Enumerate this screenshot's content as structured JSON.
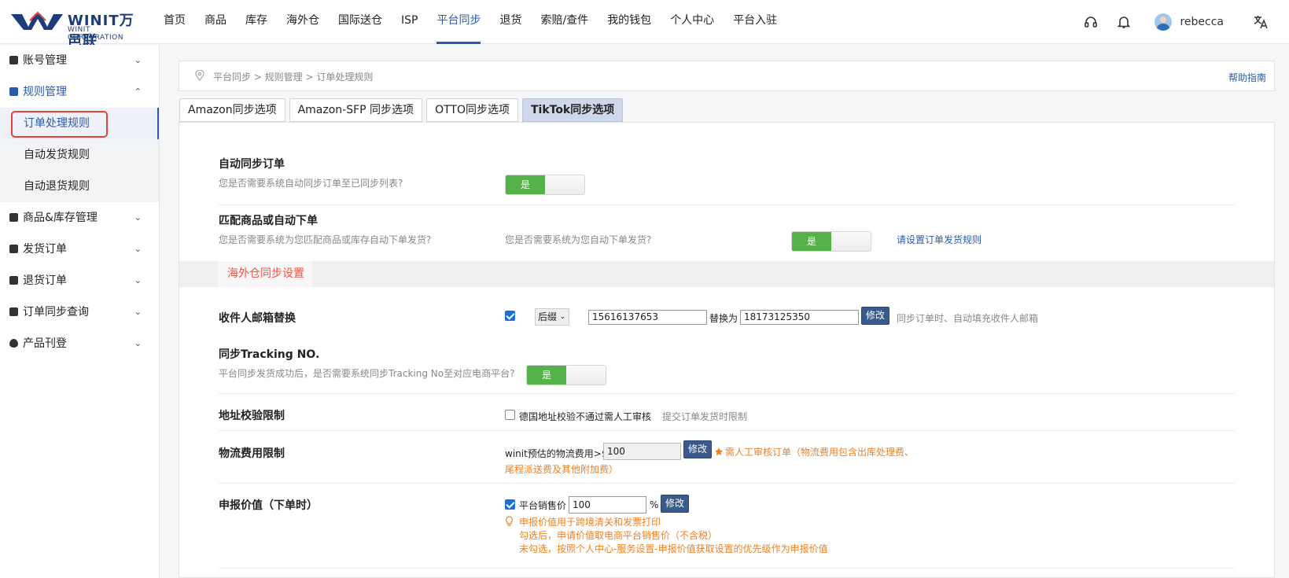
{
  "brand": {
    "name": "WINIT万邑联",
    "sub": "WINIT CORPORATION"
  },
  "nav": [
    "首页",
    "商品",
    "库存",
    "海外仓",
    "国际送仓",
    "ISP",
    "平台同步",
    "退货",
    "索赔/查件",
    "我的钱包",
    "个人中心",
    "平台入驻"
  ],
  "nav_active": "平台同步",
  "user": {
    "name": "rebecca"
  },
  "sidebar": {
    "groups": [
      {
        "label": "账号管理",
        "icon": "wallet-icon"
      },
      {
        "label": "规则管理",
        "icon": "book-icon",
        "open": true
      },
      {
        "label": "商品&库存管理",
        "icon": "bag-icon"
      },
      {
        "label": "发货订单",
        "icon": "clipboard-icon"
      },
      {
        "label": "退货订单",
        "icon": "document-icon"
      },
      {
        "label": "订单同步查询",
        "icon": "copy-icon"
      },
      {
        "label": "产品刊登",
        "icon": "flame-icon"
      }
    ],
    "rules_sub": [
      "订单处理规则",
      "自动发货规则",
      "自动退货规则"
    ]
  },
  "breadcrumb": "平台同步 > 规则管理 > 订单处理规则",
  "help": "帮助指南",
  "tabs": [
    "Amazon同步选项",
    "Amazon-SFP 同步选项",
    "OTTO同步选项",
    "TikTok同步选项"
  ],
  "tab_active": "TikTok同步选项",
  "auto_sync": {
    "title": "自动同步订单",
    "desc": "您是否需要系统自动同步订单至已同步列表?",
    "toggle": "是"
  },
  "match": {
    "title": "匹配商品或自动下单",
    "desc": "您是否需要系统为您匹配商品或库存自动下单发货?",
    "desc2": "您是否需要系统为您自动下单发货?",
    "toggle": "是",
    "link": "请设置订单发货规则"
  },
  "section": {
    "title": "海外仓同步设置"
  },
  "email": {
    "title": "收件人邮箱替换",
    "select": "后缀",
    "from": "15616137653",
    "replace_label": "替换为",
    "to": "18173125350",
    "button": "修改",
    "note": "同步订单时、自动填充收件人邮箱"
  },
  "tracking": {
    "title": "同步Tracking NO.",
    "desc": "平台同步发货成功后，是否需要系统同步Tracking No至对应电商平台?",
    "toggle": "是"
  },
  "address": {
    "title": "地址校验限制",
    "check_label": "德国地址校验不通过需人工审核",
    "note": "提交订单发货时限制"
  },
  "logistics": {
    "title": "物流费用限制",
    "label": "winit预估的物流费用>$",
    "value": "100",
    "button": "修改",
    "warn1": "需人工审核订单（物流费用包含出库处理费、",
    "warn2": "尾程派送费及其他附加费）"
  },
  "declare": {
    "title": "申报价值（下单时）",
    "check_label": "平台销售价",
    "value": "100",
    "unit": "%",
    "button": "修改",
    "tip1": "申报价值用于跨境清关和发票打印",
    "tip2": "勾选后，申请价值取电商平台销售价（不含税）",
    "tip3": "未勾选，按照个人中心-服务设置-申报价值获取设置的优先级作为申报价值"
  }
}
